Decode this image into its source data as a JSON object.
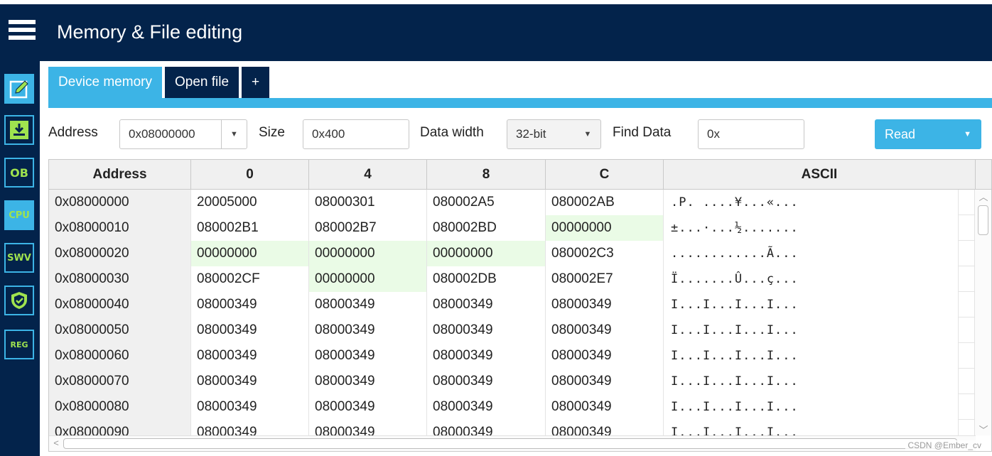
{
  "header": {
    "title": "Memory & File editing",
    "menu_icon": "hamburger-menu-icon"
  },
  "sidebar": {
    "items": [
      {
        "name": "memory-edit",
        "icon": "pencil-edit-icon",
        "label": "",
        "active": true
      },
      {
        "name": "download",
        "icon": "download-icon",
        "label": "",
        "active": false
      },
      {
        "name": "option-bytes",
        "icon": "ob-icon",
        "label": "OB",
        "active": false
      },
      {
        "name": "cpu",
        "icon": "cpu-icon",
        "label": "CPU",
        "active": false
      },
      {
        "name": "swv",
        "icon": "swv-icon",
        "label": "SWV",
        "active": false
      },
      {
        "name": "security",
        "icon": "shield-icon",
        "label": "",
        "active": false
      },
      {
        "name": "registers",
        "icon": "reg-icon",
        "label": "REG",
        "active": false
      }
    ]
  },
  "tabs": [
    {
      "label": "Device memory",
      "active": true
    },
    {
      "label": "Open file",
      "active": false
    },
    {
      "label": "+",
      "active": false
    }
  ],
  "toolbar": {
    "address_label": "Address",
    "address_value": "0x08000000",
    "size_label": "Size",
    "size_value": "0x400",
    "data_width_label": "Data width",
    "data_width_value": "32-bit",
    "find_label": "Find Data",
    "find_value": "0x",
    "read_label": "Read"
  },
  "table": {
    "headers": [
      "Address",
      "0",
      "4",
      "8",
      "C",
      "ASCII"
    ],
    "rows": [
      {
        "address": "0x08000000",
        "values": [
          "20005000",
          "08000301",
          "080002A5",
          "080002AB"
        ],
        "ascii": ".P.  ....¥...«..."
      },
      {
        "address": "0x08000010",
        "values": [
          "080002B1",
          "080002B7",
          "080002BD",
          "00000000"
        ],
        "ascii": "±...·...½......."
      },
      {
        "address": "0x08000020",
        "values": [
          "00000000",
          "00000000",
          "00000000",
          "080002C3"
        ],
        "ascii": "............Ã..."
      },
      {
        "address": "0x08000030",
        "values": [
          "080002CF",
          "00000000",
          "080002DB",
          "080002E7"
        ],
        "ascii": "Ï.......Û...ç..."
      },
      {
        "address": "0x08000040",
        "values": [
          "08000349",
          "08000349",
          "08000349",
          "08000349"
        ],
        "ascii": "I...I...I...I..."
      },
      {
        "address": "0x08000050",
        "values": [
          "08000349",
          "08000349",
          "08000349",
          "08000349"
        ],
        "ascii": "I...I...I...I..."
      },
      {
        "address": "0x08000060",
        "values": [
          "08000349",
          "08000349",
          "08000349",
          "08000349"
        ],
        "ascii": "I...I...I...I..."
      },
      {
        "address": "0x08000070",
        "values": [
          "08000349",
          "08000349",
          "08000349",
          "08000349"
        ],
        "ascii": "I...I...I...I..."
      },
      {
        "address": "0x08000080",
        "values": [
          "08000349",
          "08000349",
          "08000349",
          "08000349"
        ],
        "ascii": "I...I...I...I..."
      },
      {
        "address": "0x08000090",
        "values": [
          "08000349",
          "08000349",
          "08000349",
          "08000349"
        ],
        "ascii": "I...I...I...I..."
      }
    ]
  },
  "colors": {
    "header_bg": "#03234b",
    "accent": "#3cb4e6",
    "sidebar_icon_green": "#9fe34f",
    "zero_cell_bg": "#eafbe6"
  },
  "watermark": "CSDN @Ember_cv"
}
